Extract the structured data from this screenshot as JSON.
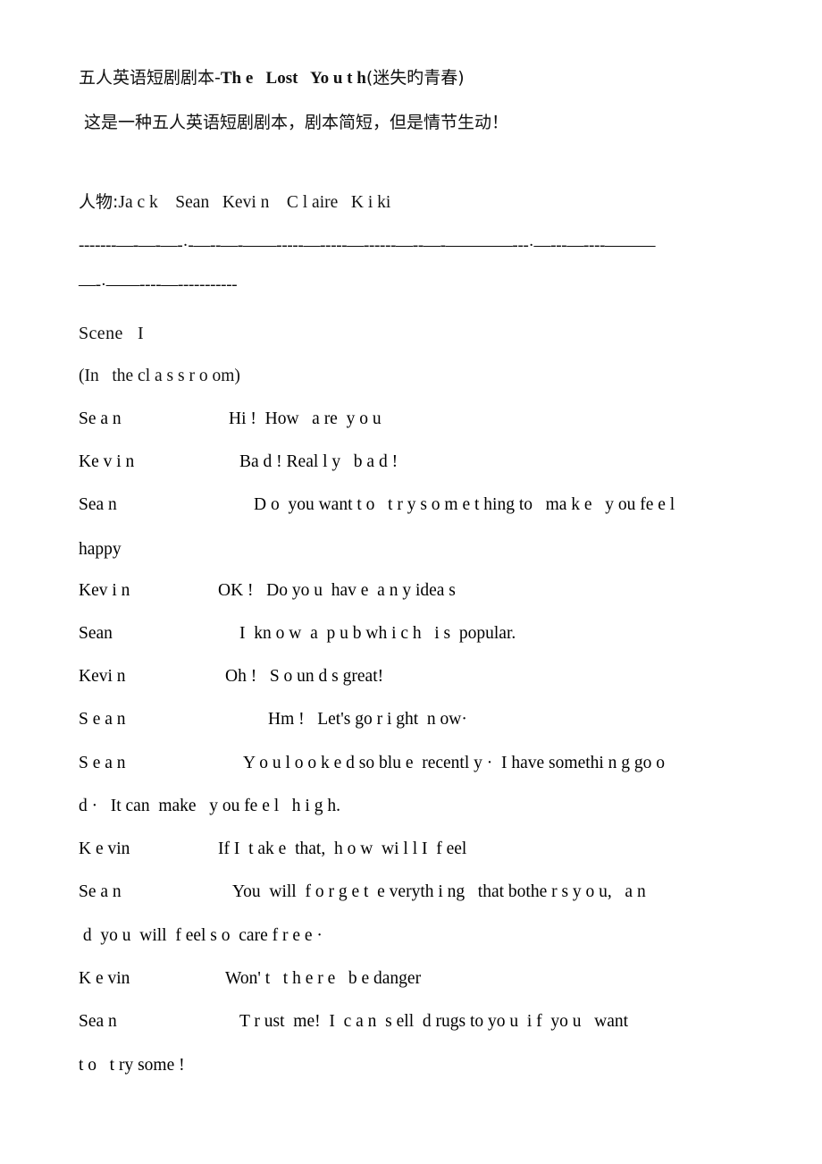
{
  "document": {
    "title_cjk_prefix": "五人英语短剧剧本-",
    "title_latin": "Th e   Lost   Yo u t h",
    "title_cjk_suffix": "(迷失旳青春)",
    "intro": " 这是一种五人英语短剧剧本，剧本简短，但是情节生动！",
    "cast_label": "人物:",
    "cast_latin": "Ja c k    Sean   Kevi n    C l aire   K i ki",
    "rule_line_1": "-------—-—-—-·-—--—-——-----—-----—------—--—-————---·—---—----———",
    "rule_line_2": "—-·——----—-----------",
    "scene_heading": "Scene   I",
    "stage_direction": "(In   the cl a s s r o om)"
  },
  "dialogue": [
    {
      "speaker": "Se a n",
      "speech": "Hi !  How   a re  y o u",
      "speech_indent": 168
    },
    {
      "speaker": "Ke v i n",
      "speech": "Ba d ! Real l y   b a d !",
      "speech_indent": 180
    },
    {
      "speaker": "Sea n",
      "speech": "D o  you want t o   t r y s o m e t hing to   ma k e   y ou fe e l",
      "speech_indent": 196
    },
    {
      "speaker": "Kev i n",
      "speech": "OK !   Do yo u  hav e  a n y idea s",
      "speech_indent": 156
    },
    {
      "speaker": "Sean",
      "speech": "I  kn o w  a  p u b wh i c h   i s  popular.",
      "speech_indent": 180
    },
    {
      "speaker": "Kevi n",
      "speech": "Oh !   S o un d s great!",
      "speech_indent": 164
    },
    {
      "speaker": "S e a n",
      "speech": "Hm !   Let's go r i ght  n ow·",
      "speech_indent": 212
    },
    {
      "speaker": "S e a n",
      "speech": "Y o u l o o k e d so blu e  recentl y ·  I have somethi n g go o",
      "speech_indent": 184
    },
    {
      "speaker": "K e vin",
      "speech": "If I  t ak e  that,  h o w  wi l l I  f eel",
      "speech_indent": 156
    },
    {
      "speaker": "Se a n",
      "speech": "You  will  f o r g e t  e veryth i ng   that bothe r s y o u,   a n",
      "speech_indent": 172
    },
    {
      "speaker": "K e vin",
      "speech": "Won' t   t h e r e   b e danger",
      "speech_indent": 164
    },
    {
      "speaker": "Sea n",
      "speech": "T r ust  me!  I  c a n  s ell  d rugs to yo u  i f  yo u   want",
      "speech_indent": 180
    }
  ],
  "continuations": {
    "happy": "happy",
    "good_period": "d ·   It can  make   y ou fe e l   h i g h.",
    "carefree": " d  yo u  will  f eel s o  care f r e e ·",
    "try_some": "t o   t ry some !"
  }
}
